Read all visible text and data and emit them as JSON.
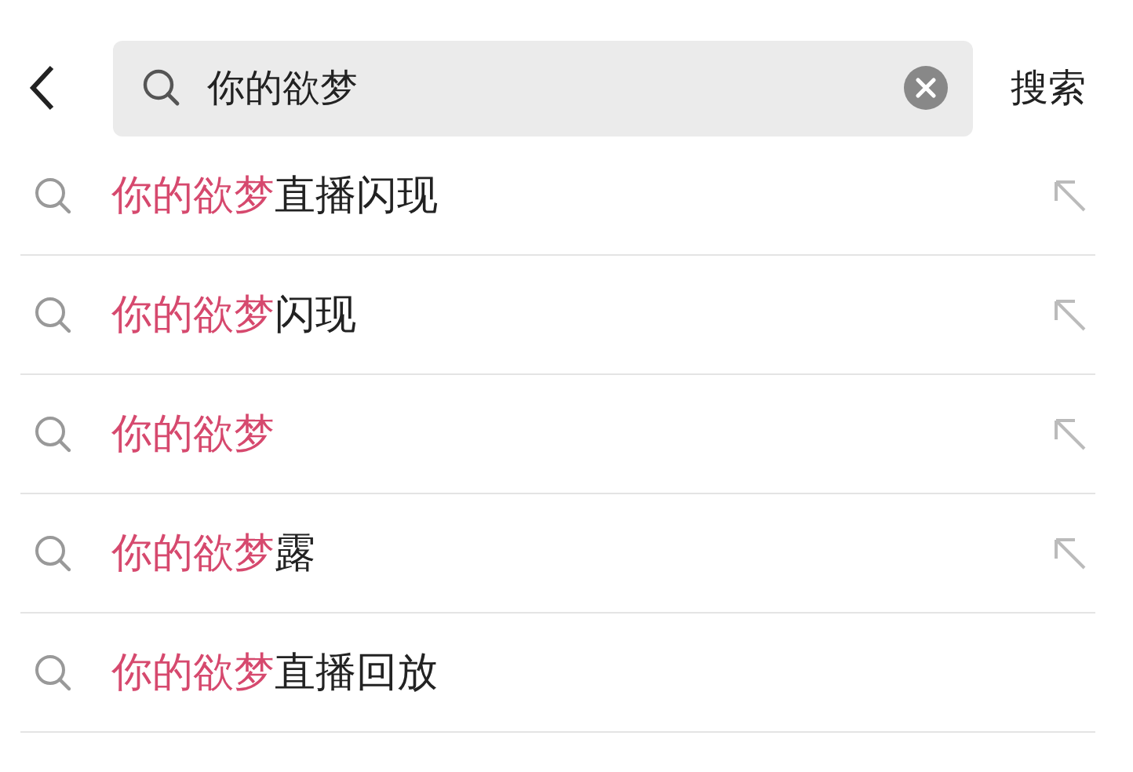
{
  "search": {
    "value": "你的欲梦",
    "action": "搜索"
  },
  "suggestions": [
    {
      "match": "你的欲梦",
      "rest": "直播闪现",
      "fill_arrow": true
    },
    {
      "match": "你的欲梦",
      "rest": "闪现",
      "fill_arrow": true
    },
    {
      "match": "你的欲梦",
      "fill_arrow": true
    },
    {
      "match": "你的欲梦",
      "rest": "露",
      "fill_arrow": true
    },
    {
      "match": "你的欲梦",
      "rest": "直播回放",
      "fill_arrow": false
    }
  ]
}
